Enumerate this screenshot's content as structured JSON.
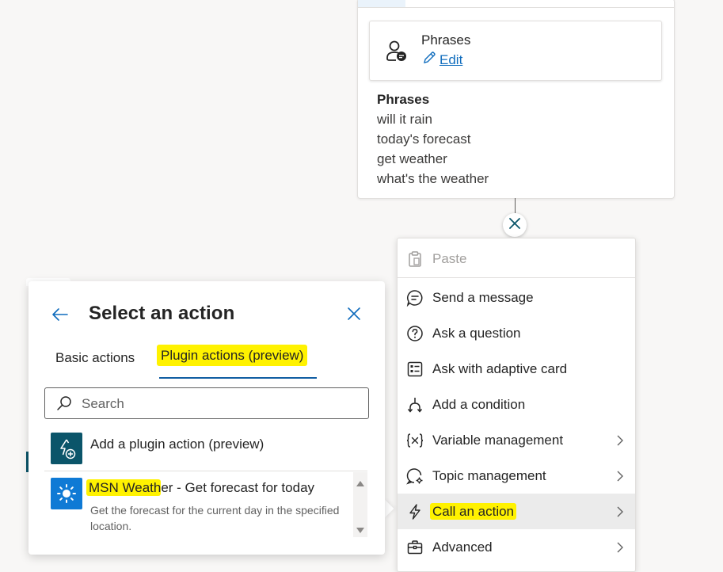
{
  "trigger": {
    "card_title": "Phrases",
    "edit_label": "Edit",
    "phrases_heading": "Phrases",
    "phrases": [
      "will it rain",
      "today's forecast",
      "get weather",
      "what's the weather"
    ]
  },
  "node_menu": {
    "items": [
      {
        "label": "Paste",
        "icon": "paste-icon",
        "disabled": true
      },
      {
        "label": "Send a message",
        "icon": "chat-icon"
      },
      {
        "label": "Ask a question",
        "icon": "question-icon"
      },
      {
        "label": "Ask with adaptive card",
        "icon": "adaptive-card-icon"
      },
      {
        "label": "Add a condition",
        "icon": "branch-icon"
      },
      {
        "label": "Variable management",
        "icon": "variable-icon",
        "submenu": true
      },
      {
        "label": "Topic management",
        "icon": "topic-settings-icon",
        "submenu": true
      },
      {
        "label": "Call an action",
        "icon": "flash-icon",
        "submenu": true,
        "active": true,
        "highlighted": true
      },
      {
        "label": "Advanced",
        "icon": "briefcase-icon",
        "submenu": true
      }
    ]
  },
  "action_panel": {
    "title": "Select an action",
    "tabs": [
      {
        "label": "Basic actions"
      },
      {
        "label": "Plugin actions (preview)",
        "selected": true,
        "highlighted": true
      }
    ],
    "search": {
      "placeholder": "Search",
      "value": ""
    },
    "add_plugin_label": "Add a plugin action (preview)",
    "results": [
      {
        "title_highlight": "MSN Weath",
        "title_rest": "er - Get forecast for today",
        "description": "Get the forecast for the current day in the specified location.",
        "icon": "sun-icon"
      }
    ]
  },
  "colors": {
    "accent": "#0f6cbd",
    "highlight": "#fff200",
    "plugin_icon_bg": "#0b556a",
    "weather_icon_bg": "#0f7ad5",
    "active_menu_bg": "#ebebeb"
  }
}
